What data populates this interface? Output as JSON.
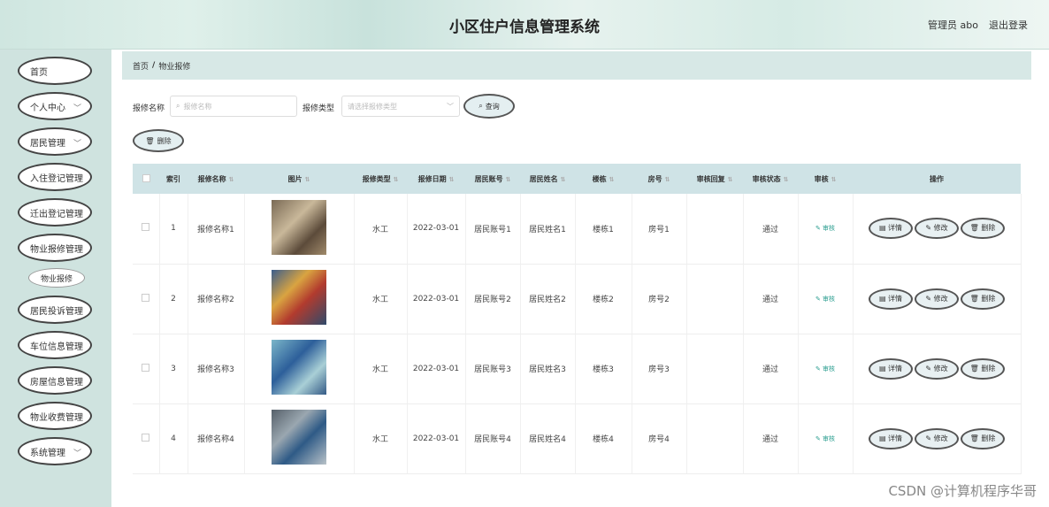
{
  "header": {
    "title": "小区住户信息管理系统",
    "admin": "管理员 abo",
    "logout": "退出登录"
  },
  "sidebar": {
    "items": [
      {
        "label": "首页"
      },
      {
        "label": "个人中心",
        "chevron": true
      },
      {
        "label": "居民管理",
        "chevron": true
      },
      {
        "label": "入住登记管理",
        "chevron": true
      },
      {
        "label": "迁出登记管理",
        "chevron": true
      },
      {
        "label": "物业报修管理",
        "chevron": false
      },
      {
        "label": "居民投诉管理",
        "chevron": true
      },
      {
        "label": "车位信息管理",
        "chevron": true
      },
      {
        "label": "房屋信息管理",
        "chevron": true
      },
      {
        "label": "物业收费管理",
        "chevron": true
      },
      {
        "label": "系统管理",
        "chevron": true
      }
    ],
    "sub_item": "物业报修"
  },
  "breadcrumb": {
    "home": "首页",
    "sep": "/",
    "current": "物业报修"
  },
  "search": {
    "name_label": "报修名称",
    "name_placeholder": "报修名称",
    "type_label": "报修类型",
    "type_placeholder": "请选择报修类型",
    "query_button": "查询",
    "delete_button": "删除"
  },
  "table": {
    "headers": [
      "索引",
      "报修名称",
      "图片",
      "报修类型",
      "报修日期",
      "居民账号",
      "居民姓名",
      "楼栋",
      "房号",
      "审核回复",
      "审核状态",
      "审核",
      "操作"
    ],
    "rows": [
      {
        "index": "1",
        "name": "报修名称1",
        "type": "水工",
        "date": "2022-03-01",
        "account": "居民账号1",
        "resident": "居民姓名1",
        "building": "楼栋1",
        "room": "房号1",
        "reply": "",
        "status": "通过",
        "audit": "审核"
      },
      {
        "index": "2",
        "name": "报修名称2",
        "type": "水工",
        "date": "2022-03-01",
        "account": "居民账号2",
        "resident": "居民姓名2",
        "building": "楼栋2",
        "room": "房号2",
        "reply": "",
        "status": "通过",
        "audit": "审核"
      },
      {
        "index": "3",
        "name": "报修名称3",
        "type": "水工",
        "date": "2022-03-01",
        "account": "居民账号3",
        "resident": "居民姓名3",
        "building": "楼栋3",
        "room": "房号3",
        "reply": "",
        "status": "通过",
        "audit": "审核"
      },
      {
        "index": "4",
        "name": "报修名称4",
        "type": "水工",
        "date": "2022-03-01",
        "account": "居民账号4",
        "resident": "居民姓名4",
        "building": "楼栋4",
        "room": "房号4",
        "reply": "",
        "status": "通过",
        "audit": "审核"
      }
    ],
    "actions": {
      "detail": "详情",
      "edit": "修改",
      "delete": "删除"
    }
  },
  "watermark": "CSDN @计算机程序华哥"
}
